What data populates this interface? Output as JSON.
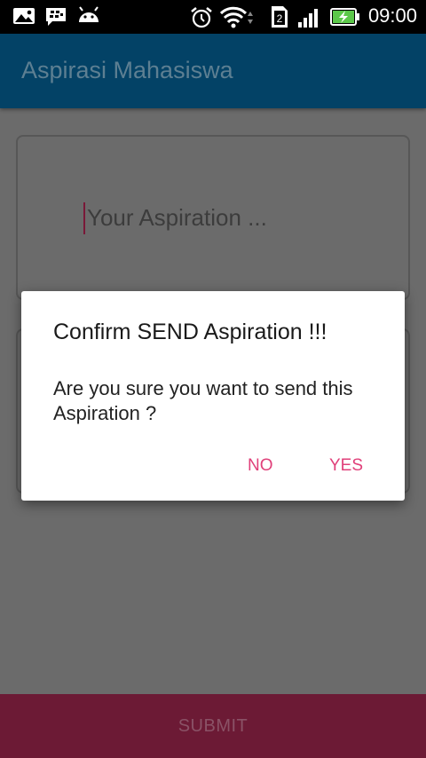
{
  "status_bar": {
    "time": "09:00",
    "sim_slot": "2",
    "icons": [
      "gallery-icon",
      "bbm-icon",
      "android-icon",
      "alarm-icon",
      "wifi-icon",
      "sim-icon",
      "signal-icon",
      "battery-charging-icon"
    ]
  },
  "app_bar": {
    "title": "Aspirasi Mahasiswa"
  },
  "form": {
    "aspiration_placeholder": "Your Aspiration ...",
    "submit_label": "SUBMIT"
  },
  "dialog": {
    "title": "Confirm SEND Aspiration !!!",
    "message": "Are you sure you want to send this Aspiration ?",
    "no_label": "NO",
    "yes_label": "YES"
  },
  "colors": {
    "accent": "#e0407a",
    "app_bar": "#034266",
    "submit_bar": "#6c1a35",
    "scrim": "#6b6b6b"
  }
}
